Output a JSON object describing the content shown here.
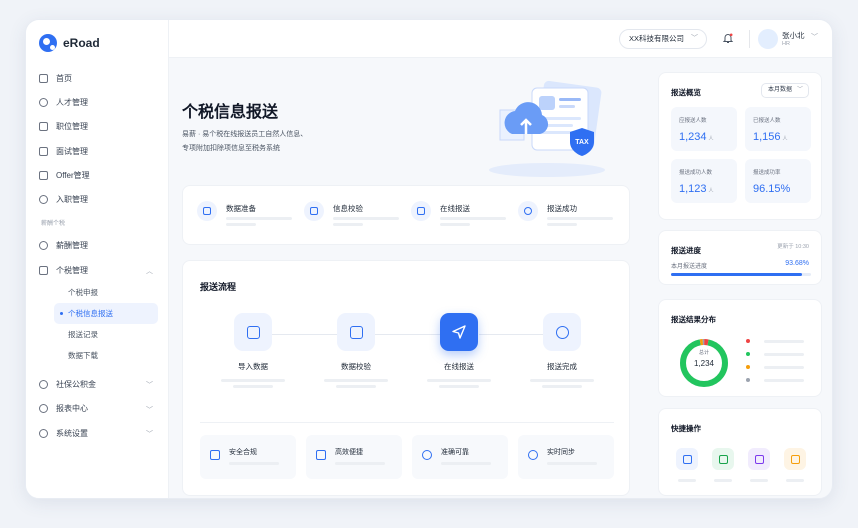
{
  "app": {
    "name": "eRoad"
  },
  "sidebar": {
    "items_top": [
      {
        "label": "首页"
      },
      {
        "label": "人才管理"
      },
      {
        "label": "职位管理"
      },
      {
        "label": "面试管理"
      },
      {
        "label": "Offer管理"
      },
      {
        "label": "入职管理"
      }
    ],
    "group_label": "薪酬个税",
    "salary": {
      "label": "薪酬管理"
    },
    "tax": {
      "label": "个税管理"
    },
    "tax_sub": [
      {
        "label": "个税申报"
      },
      {
        "label": "个税信息报送"
      },
      {
        "label": "报送记录"
      },
      {
        "label": "数据下载"
      }
    ],
    "items_bottom": [
      {
        "label": "社保公积金"
      },
      {
        "label": "报表中心"
      },
      {
        "label": "系统设置"
      }
    ]
  },
  "topbar": {
    "company": "XX科技有限公司",
    "user_name": "张小北",
    "user_role": "HR"
  },
  "hero": {
    "title": "个税信息报送",
    "desc_line1": "易薪 · 易个税在线报送员工自然人信息、",
    "desc_line2": "专项附加扣除项信息至税务系统"
  },
  "steps": [
    {
      "label": "数据准备"
    },
    {
      "label": "信息校验"
    },
    {
      "label": "在线报送"
    },
    {
      "label": "报送成功"
    }
  ],
  "flow": {
    "title": "报送流程",
    "nodes": [
      {
        "label": "导入数据"
      },
      {
        "label": "数据校验"
      },
      {
        "label": "在线报送"
      },
      {
        "label": "报送完成"
      }
    ],
    "features": [
      {
        "label": "安全合规"
      },
      {
        "label": "高效便捷"
      },
      {
        "label": "准确可靠"
      },
      {
        "label": "实时同步"
      }
    ]
  },
  "overview": {
    "title": "报送概览",
    "period": "本月数据",
    "stats": [
      {
        "label": "应报送人数",
        "value": "1,234",
        "unit": "人"
      },
      {
        "label": "已报送人数",
        "value": "1,156",
        "unit": "人"
      },
      {
        "label": "报送成功人数",
        "value": "1,123",
        "unit": "人"
      },
      {
        "label": "报送成功率",
        "value": "96.15%",
        "unit": ""
      }
    ]
  },
  "progress": {
    "title": "报送进度",
    "updated": "更新于 10:30",
    "label": "本月报送进度",
    "value_text": "93.68%",
    "fraction": 0.9368
  },
  "distribution": {
    "title": "报送结果分布",
    "total_label": "总计",
    "total": "1,234",
    "colors": [
      "#ef4444",
      "#22c55e",
      "#f59e0b",
      "#9ca3af"
    ],
    "fractions": [
      0.03,
      0.94,
      0.02,
      0.01
    ]
  },
  "quick": {
    "title": "快捷操作",
    "colors": [
      "#2f6ff2",
      "#16a34a",
      "#7c3aed",
      "#f59e0b"
    ],
    "icons": [
      "upload-cloud-icon",
      "download-cloud-icon",
      "document-icon",
      "book-icon"
    ]
  }
}
